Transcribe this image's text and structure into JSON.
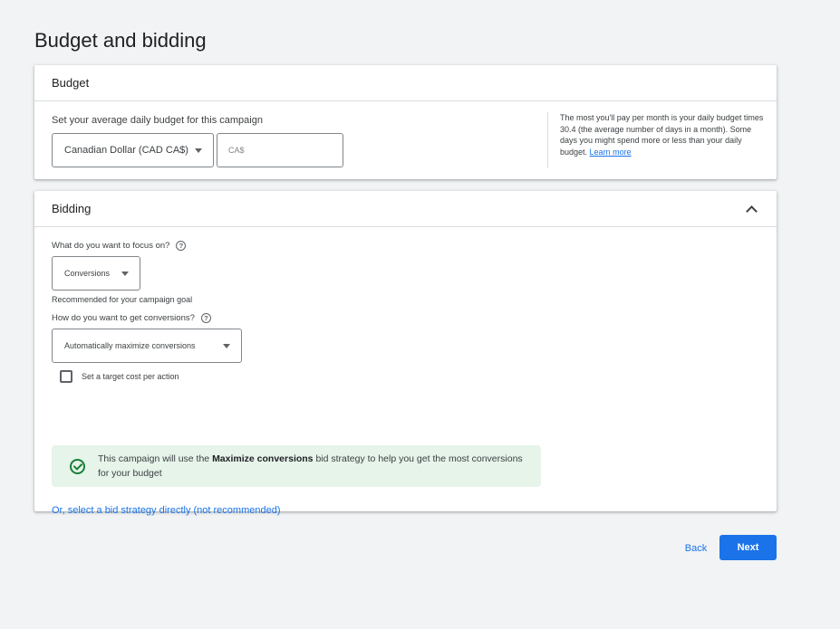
{
  "page": {
    "title": "Budget and bidding"
  },
  "budget": {
    "header": "Budget",
    "label": "Set your average daily budget for this campaign",
    "currency_value": "Canadian Dollar (CAD CA$)",
    "amount_placeholder": "CA$",
    "help_text": "The most you'll pay per month is your daily budget times 30.4 (the average number of days in a month). Some days you might spend more or less than your daily budget.",
    "learn_more": "Learn more"
  },
  "bidding": {
    "header": "Bidding",
    "focus_question": "What do you want to focus on?",
    "focus_value": "Conversions",
    "recommendation": "Recommended for your campaign goal",
    "conversions_question": "How do you want to get conversions?",
    "conversions_value": "Automatically maximize conversions",
    "target_cpa_label": "Set a target cost per action",
    "banner": {
      "prefix": "This campaign will use the ",
      "strategy": "Maximize conversions",
      "suffix": " bid strategy to help you get the most conversions for your budget"
    },
    "strategy_link": "Or, select a bid strategy directly (not recommended)"
  },
  "footer": {
    "back_label": "Back",
    "next_label": "Next"
  },
  "icons": {
    "caret": "chevron-down-icon",
    "collapse": "chevron-up-icon",
    "help": "help-icon",
    "success": "check-circle-icon"
  },
  "colors": {
    "primary": "#1a73e8",
    "success": "#188038",
    "banner_bg": "#e6f4ea"
  }
}
